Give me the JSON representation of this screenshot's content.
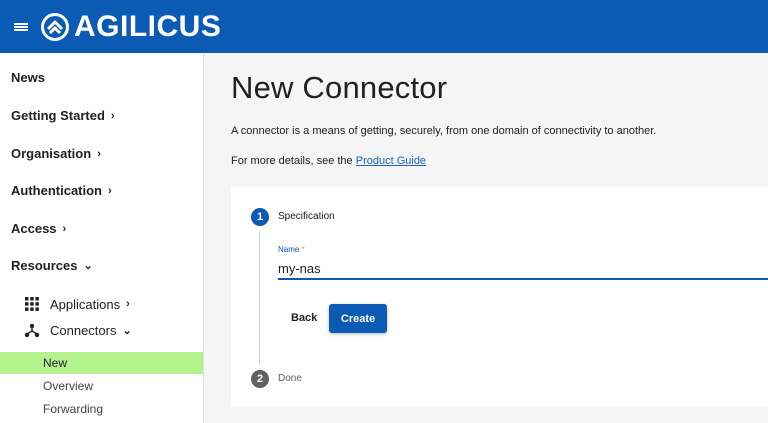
{
  "app": {
    "name": "AGILICUS",
    "brand_color": "#0b5ab4",
    "menu_icon": "hamburger-menu-icon"
  },
  "sidebar": {
    "items": [
      {
        "label": "News",
        "chevron": ""
      },
      {
        "label": "Getting Started",
        "chevron": "›"
      },
      {
        "label": "Organisation",
        "chevron": "›"
      },
      {
        "label": "Authentication",
        "chevron": "›"
      },
      {
        "label": "Access",
        "chevron": "›"
      },
      {
        "label": "Resources",
        "chevron": "⌄"
      }
    ],
    "sub_items": [
      {
        "label": "Applications",
        "icon": "grid-icon",
        "chevron": "›"
      },
      {
        "label": "Connectors",
        "icon": "connector-icon",
        "chevron": "⌄"
      }
    ],
    "leaf_items": [
      {
        "label": "New",
        "active": true
      },
      {
        "label": "Overview",
        "active": false
      },
      {
        "label": "Forwarding",
        "active": false
      }
    ],
    "active_color": "#b3f28c"
  },
  "main": {
    "title": "New Connector",
    "description": "A connector is a means of getting, securely, from one domain of connectivity to another.",
    "details_prefix": "For more details, see the ",
    "details_link": "Product Guide"
  },
  "stepper": {
    "steps": [
      {
        "number": "1",
        "label": "Specification",
        "state": "active"
      },
      {
        "number": "2",
        "label": "Done",
        "state": "pending"
      }
    ],
    "field": {
      "label": "Name",
      "required_mark": "*",
      "value": "my-nas"
    },
    "back_label": "Back",
    "create_label": "Create"
  }
}
